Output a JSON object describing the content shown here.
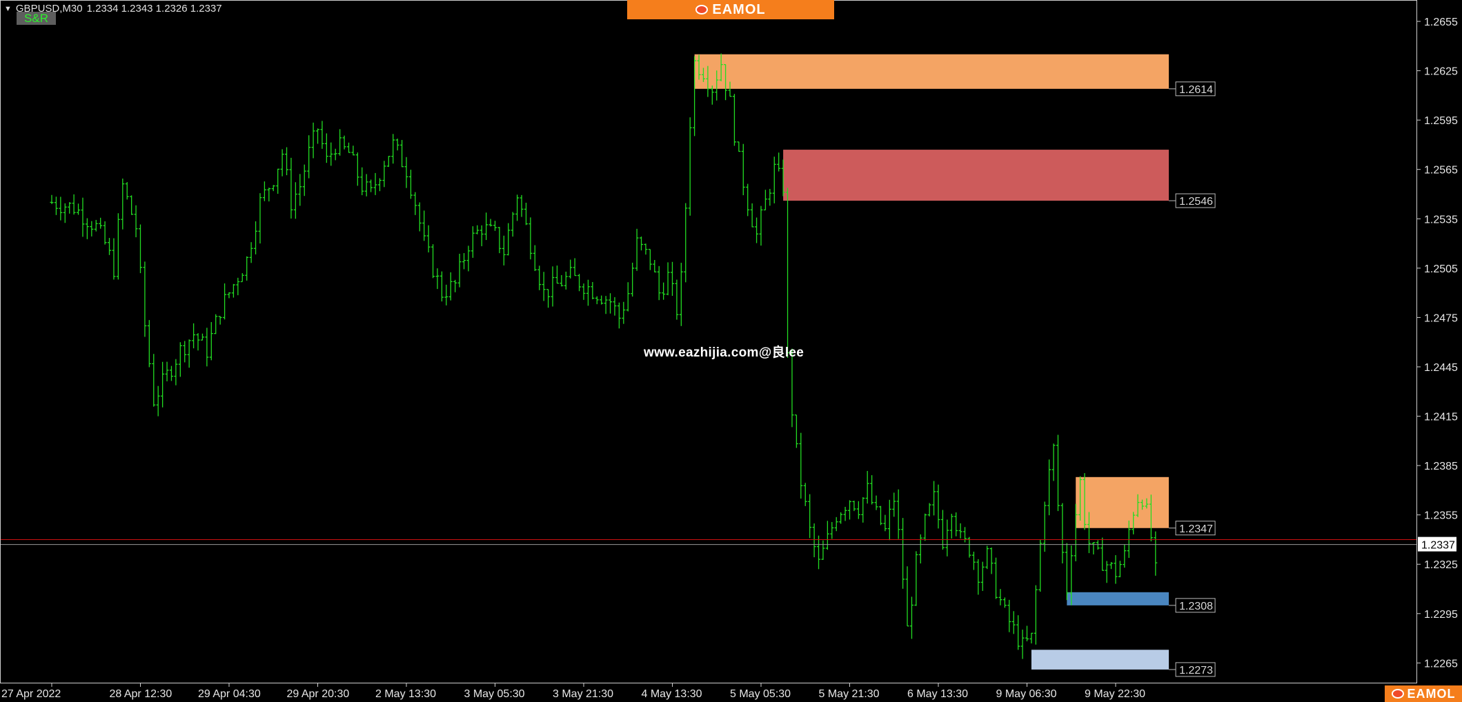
{
  "header": {
    "symbol": "GBPUSD,M30",
    "ohlc": "1.2334 1.2343 1.2326 1.2337",
    "indicator_badge": "S&R"
  },
  "banner": {
    "logo_text": "EAMOL",
    "icon": "eamol-logo-icon"
  },
  "bottom_logo": {
    "logo_text": "EAMOL",
    "icon": "eamol-logo-icon"
  },
  "watermark": "www.eazhijia.com@良lee",
  "colors": {
    "background": "#000000",
    "candle": "#22dd22",
    "current_price_line": "#cc1111",
    "bid_line": "#9a9a9a",
    "resistance_strong": "#f4a464",
    "resistance": "#cd5b5b",
    "support": "#4a86c0",
    "support_weak": "#b8cce6"
  },
  "chart_data": {
    "type": "candlestick",
    "title": "",
    "timeframe": "M30",
    "ylim": [
      1.2253,
      1.2668
    ],
    "y_ticks": [
      "1.2655",
      "1.2625",
      "1.2595",
      "1.2565",
      "1.2535",
      "1.2505",
      "1.2475",
      "1.2445",
      "1.2415",
      "1.2385",
      "1.2355",
      "1.2325",
      "1.2295",
      "1.2265"
    ],
    "x_ticks": [
      "27 Apr 2022",
      "28 Apr 12:30",
      "29 Apr 04:30",
      "29 Apr 20:30",
      "2 May 13:30",
      "3 May 05:30",
      "3 May 21:30",
      "4 May 13:30",
      "5 May 05:30",
      "5 May 21:30",
      "6 May 13:30",
      "9 May 06:30",
      "9 May 22:30"
    ],
    "x_range_ticks": [
      -0.4,
      12.3
    ],
    "price_path": [
      [
        0.0,
        1.2545
      ],
      [
        0.25,
        1.2542
      ],
      [
        0.5,
        1.253
      ],
      [
        0.6,
        1.252
      ],
      [
        0.7,
        1.2505
      ],
      [
        0.8,
        1.2555
      ],
      [
        0.95,
        1.253
      ],
      [
        1.05,
        1.247
      ],
      [
        1.15,
        1.2425
      ],
      [
        1.3,
        1.244
      ],
      [
        1.45,
        1.2455
      ],
      [
        1.6,
        1.2465
      ],
      [
        1.75,
        1.2455
      ],
      [
        1.9,
        1.248
      ],
      [
        2.05,
        1.2495
      ],
      [
        2.2,
        1.251
      ],
      [
        2.35,
        1.2545
      ],
      [
        2.5,
        1.256
      ],
      [
        2.6,
        1.2575
      ],
      [
        2.7,
        1.2545
      ],
      [
        2.8,
        1.2555
      ],
      [
        2.9,
        1.2575
      ],
      [
        3.0,
        1.259
      ],
      [
        3.1,
        1.257
      ],
      [
        3.2,
        1.258
      ],
      [
        3.35,
        1.2575
      ],
      [
        3.5,
        1.2555
      ],
      [
        3.6,
        1.255
      ],
      [
        3.75,
        1.257
      ],
      [
        3.85,
        1.258
      ],
      [
        4.0,
        1.2565
      ],
      [
        4.1,
        1.2545
      ],
      [
        4.2,
        1.252
      ],
      [
        4.3,
        1.2505
      ],
      [
        4.4,
        1.249
      ],
      [
        4.55,
        1.2495
      ],
      [
        4.7,
        1.252
      ],
      [
        4.85,
        1.253
      ],
      [
        5.0,
        1.2525
      ],
      [
        5.1,
        1.2515
      ],
      [
        5.25,
        1.255
      ],
      [
        5.35,
        1.253
      ],
      [
        5.45,
        1.251
      ],
      [
        5.55,
        1.249
      ],
      [
        5.7,
        1.2495
      ],
      [
        5.85,
        1.25
      ],
      [
        6.0,
        1.2495
      ],
      [
        6.15,
        1.249
      ],
      [
        6.3,
        1.2485
      ],
      [
        6.4,
        1.2475
      ],
      [
        6.5,
        1.249
      ],
      [
        6.6,
        1.252
      ],
      [
        6.75,
        1.251
      ],
      [
        6.85,
        1.249
      ],
      [
        6.95,
        1.25
      ],
      [
        7.05,
        1.248
      ],
      [
        7.12,
        1.2505
      ],
      [
        7.18,
        1.258
      ],
      [
        7.25,
        1.263
      ],
      [
        7.35,
        1.2625
      ],
      [
        7.45,
        1.2615
      ],
      [
        7.55,
        1.263
      ],
      [
        7.65,
        1.2605
      ],
      [
        7.75,
        1.257
      ],
      [
        7.85,
        1.2545
      ],
      [
        7.95,
        1.2525
      ],
      [
        8.05,
        1.2545
      ],
      [
        8.15,
        1.2565
      ],
      [
        8.25,
        1.2555
      ],
      [
        8.3,
        1.245
      ],
      [
        8.38,
        1.24
      ],
      [
        8.45,
        1.2375
      ],
      [
        8.55,
        1.2345
      ],
      [
        8.65,
        1.2325
      ],
      [
        8.75,
        1.234
      ],
      [
        8.85,
        1.2355
      ],
      [
        9.0,
        1.2365
      ],
      [
        9.1,
        1.236
      ],
      [
        9.2,
        1.237
      ],
      [
        9.3,
        1.2355
      ],
      [
        9.4,
        1.2345
      ],
      [
        9.5,
        1.2365
      ],
      [
        9.58,
        1.233
      ],
      [
        9.65,
        1.2285
      ],
      [
        9.75,
        1.2325
      ],
      [
        9.85,
        1.235
      ],
      [
        9.95,
        1.2365
      ],
      [
        10.05,
        1.234
      ],
      [
        10.15,
        1.236
      ],
      [
        10.25,
        1.234
      ],
      [
        10.35,
        1.2335
      ],
      [
        10.45,
        1.232
      ],
      [
        10.55,
        1.233
      ],
      [
        10.65,
        1.231
      ],
      [
        10.75,
        1.2295
      ],
      [
        10.85,
        1.2285
      ],
      [
        10.95,
        1.2275
      ],
      [
        11.05,
        1.228
      ],
      [
        11.12,
        1.232
      ],
      [
        11.2,
        1.2365
      ],
      [
        11.3,
        1.2395
      ],
      [
        11.38,
        1.234
      ],
      [
        11.45,
        1.231
      ],
      [
        11.52,
        1.2345
      ],
      [
        11.6,
        1.2375
      ],
      [
        11.68,
        1.234
      ],
      [
        11.78,
        1.233
      ],
      [
        11.9,
        1.2325
      ],
      [
        12.0,
        1.232
      ],
      [
        12.1,
        1.233
      ],
      [
        12.18,
        1.2355
      ],
      [
        12.28,
        1.237
      ],
      [
        12.38,
        1.235
      ],
      [
        12.45,
        1.232
      ],
      [
        12.5,
        1.2337
      ]
    ],
    "zones": [
      {
        "type": "resistance",
        "price_top": 1.2635,
        "price_bottom": 1.2614,
        "x_start": 7.25,
        "x_end": 12.6,
        "label": "1.2614",
        "color": "#f4a464"
      },
      {
        "type": "resistance",
        "price_top": 1.2577,
        "price_bottom": 1.2546,
        "x_start": 8.25,
        "x_end": 12.6,
        "label": "1.2546",
        "color": "#cd5b5b"
      },
      {
        "type": "resistance",
        "price_top": 1.2378,
        "price_bottom": 1.2347,
        "x_start": 11.55,
        "x_end": 12.6,
        "label": "1.2347",
        "color": "#f4a464"
      },
      {
        "type": "support",
        "price_top": 1.2308,
        "price_bottom": 1.23,
        "x_start": 11.45,
        "x_end": 12.6,
        "label": "1.2308",
        "color": "#4a86c0"
      },
      {
        "type": "support",
        "price_top": 1.2273,
        "price_bottom": 1.2261,
        "x_start": 11.05,
        "x_end": 12.6,
        "label": "1.2273",
        "color": "#b8cce6"
      }
    ],
    "current_price": "1.2337",
    "ask_price": 1.234,
    "bid_price": 1.2337,
    "grid": false,
    "legend": "none"
  }
}
